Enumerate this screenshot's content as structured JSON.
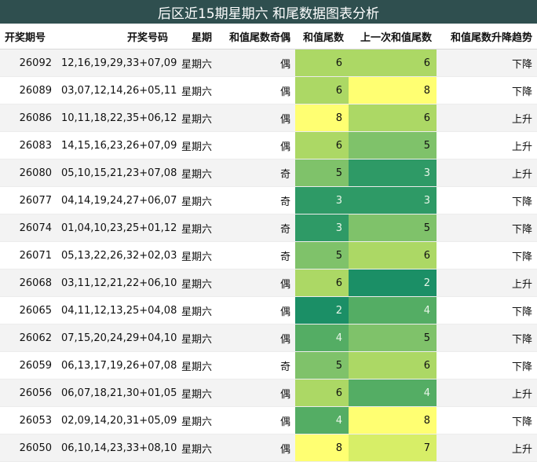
{
  "title": "后区近15期星期六 和尾数据图表分析",
  "columns": [
    "开奖期号",
    "开奖号码",
    "星期",
    "和值尾数奇偶",
    "和值尾数",
    "上一次和值尾数",
    "和值尾数升降趋势"
  ],
  "colors": {
    "0": "#007f5f",
    "1": "#0a8a63",
    "2": "#1b8f66",
    "3": "#2e9a66",
    "4": "#54ad64",
    "5": "#7fc26a",
    "6": "#acd865",
    "7": "#d7ee67",
    "8": "#ffff72",
    "text_light": "#e8f5e8",
    "text_dark": "#111111",
    "title_bg": "#2f4f4f"
  },
  "chart_data": {
    "type": "table",
    "rows": [
      {
        "issue": "26092",
        "numbers": "12,16,19,29,33+07,09",
        "weekday": "星期六",
        "parity": "偶",
        "tail": 6,
        "prev_tail": 6,
        "trend": "下降"
      },
      {
        "issue": "26089",
        "numbers": "03,07,12,14,26+05,11",
        "weekday": "星期六",
        "parity": "偶",
        "tail": 6,
        "prev_tail": 8,
        "trend": "下降"
      },
      {
        "issue": "26086",
        "numbers": "10,11,18,22,35+06,12",
        "weekday": "星期六",
        "parity": "偶",
        "tail": 8,
        "prev_tail": 6,
        "trend": "上升"
      },
      {
        "issue": "26083",
        "numbers": "14,15,16,23,26+07,09",
        "weekday": "星期六",
        "parity": "偶",
        "tail": 6,
        "prev_tail": 5,
        "trend": "上升"
      },
      {
        "issue": "26080",
        "numbers": "05,10,15,21,23+07,08",
        "weekday": "星期六",
        "parity": "奇",
        "tail": 5,
        "prev_tail": 3,
        "trend": "上升"
      },
      {
        "issue": "26077",
        "numbers": "04,14,19,24,27+06,07",
        "weekday": "星期六",
        "parity": "奇",
        "tail": 3,
        "prev_tail": 3,
        "trend": "下降"
      },
      {
        "issue": "26074",
        "numbers": "01,04,10,23,25+01,12",
        "weekday": "星期六",
        "parity": "奇",
        "tail": 3,
        "prev_tail": 5,
        "trend": "下降"
      },
      {
        "issue": "26071",
        "numbers": "05,13,22,26,32+02,03",
        "weekday": "星期六",
        "parity": "奇",
        "tail": 5,
        "prev_tail": 6,
        "trend": "下降"
      },
      {
        "issue": "26068",
        "numbers": "03,11,12,21,22+06,10",
        "weekday": "星期六",
        "parity": "偶",
        "tail": 6,
        "prev_tail": 2,
        "trend": "上升"
      },
      {
        "issue": "26065",
        "numbers": "04,11,12,13,25+04,08",
        "weekday": "星期六",
        "parity": "偶",
        "tail": 2,
        "prev_tail": 4,
        "trend": "下降"
      },
      {
        "issue": "26062",
        "numbers": "07,15,20,24,29+04,10",
        "weekday": "星期六",
        "parity": "偶",
        "tail": 4,
        "prev_tail": 5,
        "trend": "下降"
      },
      {
        "issue": "26059",
        "numbers": "06,13,17,19,26+07,08",
        "weekday": "星期六",
        "parity": "奇",
        "tail": 5,
        "prev_tail": 6,
        "trend": "下降"
      },
      {
        "issue": "26056",
        "numbers": "06,07,18,21,30+01,05",
        "weekday": "星期六",
        "parity": "偶",
        "tail": 6,
        "prev_tail": 4,
        "trend": "上升"
      },
      {
        "issue": "26053",
        "numbers": "02,09,14,20,31+05,09",
        "weekday": "星期六",
        "parity": "偶",
        "tail": 4,
        "prev_tail": 8,
        "trend": "下降"
      },
      {
        "issue": "26050",
        "numbers": "06,10,14,23,33+08,10",
        "weekday": "星期六",
        "parity": "偶",
        "tail": 8,
        "prev_tail": 7,
        "trend": "上升"
      }
    ]
  }
}
